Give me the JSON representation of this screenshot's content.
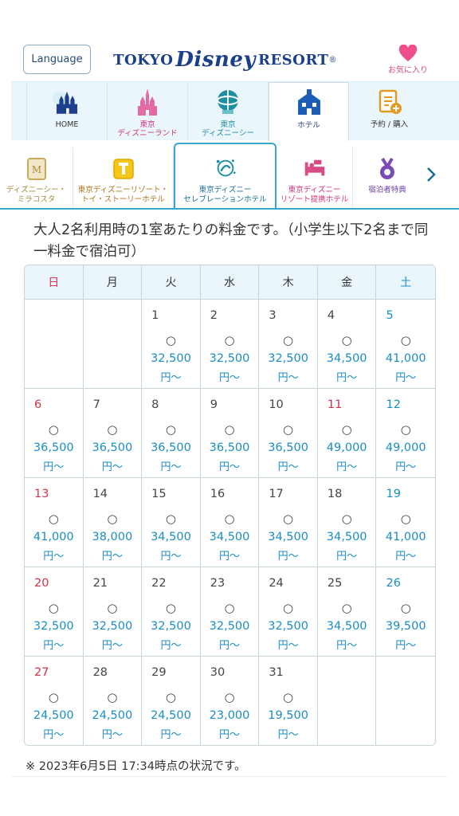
{
  "header": {
    "language_label": "Language",
    "logo_pre": "TOKYO",
    "logo_disney": "Disney",
    "logo_post": "RESORT",
    "logo_mark": "®",
    "favorites_label": "お気に入り"
  },
  "mainnav": {
    "items": [
      {
        "label": "HOME"
      },
      {
        "label_1": "東京",
        "label_2": "ディズニーランド"
      },
      {
        "label_1": "東京",
        "label_2": "ディズニーシー"
      },
      {
        "label": "ホテル"
      },
      {
        "label": "予約 / 購入"
      }
    ]
  },
  "subnav": {
    "items": [
      {
        "label_1": "ディズニーシー・",
        "label_2": "ミラコスタ"
      },
      {
        "label_1": "東京ディズニーリゾート・",
        "label_2": "トイ・ストーリーホテル"
      },
      {
        "label_1": "東京ディズニー",
        "label_2": "セレブレーションホテル"
      },
      {
        "label_1": "東京ディズニー",
        "label_2": "リゾート提携ホテル"
      },
      {
        "label": "宿泊者特典"
      }
    ]
  },
  "notice": "大人2名利用時の1室あたりの料金です。（小学生以下2名まで同一料金で宿泊可）",
  "calendar": {
    "weekdays": [
      "日",
      "月",
      "火",
      "水",
      "木",
      "金",
      "土"
    ],
    "rows": [
      [
        {
          "d": "",
          "mark": "",
          "price": "",
          "unit": ""
        },
        {
          "d": "",
          "mark": "",
          "price": "",
          "unit": ""
        },
        {
          "d": "1",
          "mark": "○",
          "price": "32,500",
          "unit": "円〜"
        },
        {
          "d": "2",
          "mark": "○",
          "price": "32,500",
          "unit": "円〜"
        },
        {
          "d": "3",
          "mark": "○",
          "price": "32,500",
          "unit": "円〜"
        },
        {
          "d": "4",
          "mark": "○",
          "price": "34,500",
          "unit": "円〜"
        },
        {
          "d": "5",
          "mark": "○",
          "price": "41,000",
          "unit": "円〜"
        }
      ],
      [
        {
          "d": "6",
          "mark": "○",
          "price": "36,500",
          "unit": "円〜"
        },
        {
          "d": "7",
          "mark": "○",
          "price": "36,500",
          "unit": "円〜"
        },
        {
          "d": "8",
          "mark": "○",
          "price": "36,500",
          "unit": "円〜"
        },
        {
          "d": "9",
          "mark": "○",
          "price": "36,500",
          "unit": "円〜"
        },
        {
          "d": "10",
          "mark": "○",
          "price": "36,500",
          "unit": "円〜"
        },
        {
          "d": "11",
          "mark": "○",
          "price": "49,000",
          "unit": "円〜"
        },
        {
          "d": "12",
          "mark": "○",
          "price": "49,000",
          "unit": "円〜"
        }
      ],
      [
        {
          "d": "13",
          "mark": "○",
          "price": "41,000",
          "unit": "円〜"
        },
        {
          "d": "14",
          "mark": "○",
          "price": "38,000",
          "unit": "円〜"
        },
        {
          "d": "15",
          "mark": "○",
          "price": "34,500",
          "unit": "円〜"
        },
        {
          "d": "16",
          "mark": "○",
          "price": "34,500",
          "unit": "円〜"
        },
        {
          "d": "17",
          "mark": "○",
          "price": "34,500",
          "unit": "円〜"
        },
        {
          "d": "18",
          "mark": "○",
          "price": "34,500",
          "unit": "円〜"
        },
        {
          "d": "19",
          "mark": "○",
          "price": "41,000",
          "unit": "円〜"
        }
      ],
      [
        {
          "d": "20",
          "mark": "○",
          "price": "32,500",
          "unit": "円〜"
        },
        {
          "d": "21",
          "mark": "○",
          "price": "32,500",
          "unit": "円〜"
        },
        {
          "d": "22",
          "mark": "○",
          "price": "32,500",
          "unit": "円〜"
        },
        {
          "d": "23",
          "mark": "○",
          "price": "32,500",
          "unit": "円〜"
        },
        {
          "d": "24",
          "mark": "○",
          "price": "32,500",
          "unit": "円〜"
        },
        {
          "d": "25",
          "mark": "○",
          "price": "34,500",
          "unit": "円〜"
        },
        {
          "d": "26",
          "mark": "○",
          "price": "39,500",
          "unit": "円〜"
        }
      ],
      [
        {
          "d": "27",
          "mark": "○",
          "price": "24,500",
          "unit": "円〜"
        },
        {
          "d": "28",
          "mark": "○",
          "price": "24,500",
          "unit": "円〜"
        },
        {
          "d": "29",
          "mark": "○",
          "price": "24,500",
          "unit": "円〜"
        },
        {
          "d": "30",
          "mark": "○",
          "price": "23,000",
          "unit": "円〜"
        },
        {
          "d": "31",
          "mark": "○",
          "price": "19,500",
          "unit": "円〜"
        },
        {
          "d": "",
          "mark": "",
          "price": "",
          "unit": ""
        },
        {
          "d": "",
          "mark": "",
          "price": "",
          "unit": ""
        }
      ]
    ],
    "holidays": [
      "11"
    ]
  },
  "footnote": "※ 2023年6月5日 17:34時点の状況です。",
  "colors": {
    "sunday": "#d2334a",
    "saturday": "#1a8ec4",
    "price": "#1a8ec4",
    "accent": "#36a5cf",
    "nav_bg": "#eaf6fb"
  },
  "icons": {
    "home": "castle-icon",
    "tdl": "pink-castle-icon",
    "tds": "globe-icon",
    "hotel": "hotel-building-icon",
    "booking": "reservation-icon",
    "miracosta": "miracosta-emblem-icon",
    "toystory": "toy-story-hotel-icon",
    "celebration": "celebration-hotel-icon",
    "partner": "partner-hotel-bed-icon",
    "perks": "medal-icon"
  }
}
